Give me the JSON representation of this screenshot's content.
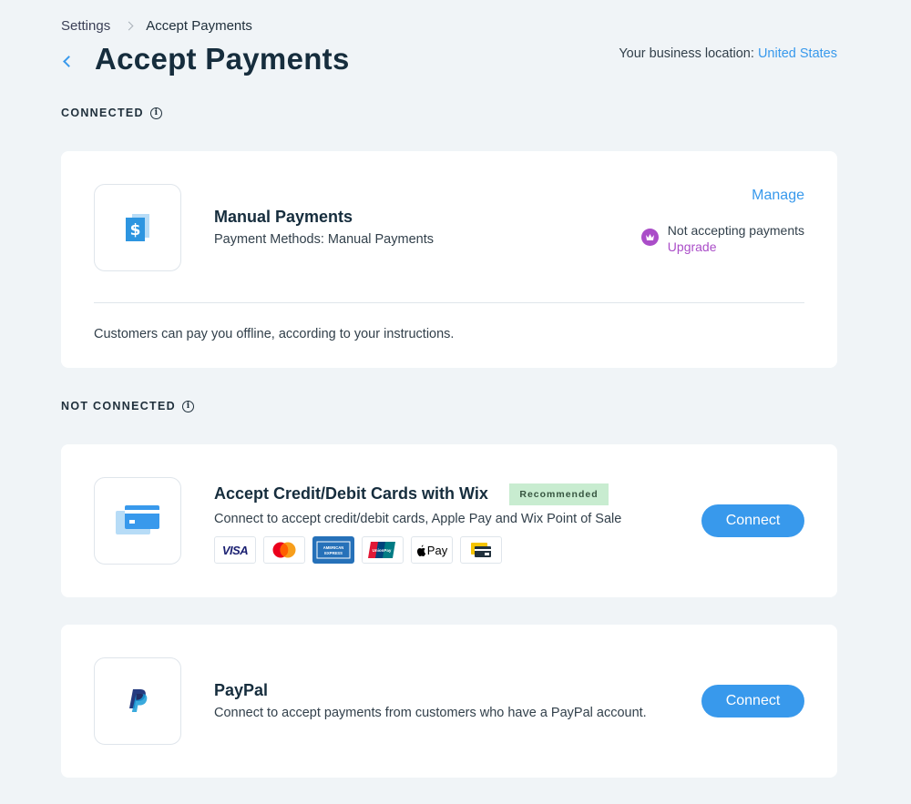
{
  "breadcrumb": {
    "parent": "Settings",
    "current": "Accept Payments"
  },
  "page": {
    "title": "Accept Payments"
  },
  "business_location": {
    "label": "Your business location:",
    "value": "United States"
  },
  "sections": {
    "connected": "CONNECTED",
    "not_connected": "NOT CONNECTED"
  },
  "manual": {
    "name": "Manual Payments",
    "methods": "Payment Methods: Manual Payments",
    "manage": "Manage",
    "status": "Not accepting payments",
    "upgrade": "Upgrade",
    "note": "Customers can pay you offline, according to your instructions."
  },
  "wix_cards": {
    "name": "Accept Credit/Debit Cards with Wix",
    "badge": "Recommended",
    "desc": "Connect to accept credit/debit cards, Apple Pay and Wix Point of Sale",
    "connect": "Connect",
    "logos": [
      "visa",
      "mastercard",
      "american-express",
      "unionpay",
      "apple-pay",
      "wix-pos"
    ]
  },
  "paypal": {
    "name": "PayPal",
    "desc": "Connect to accept payments from customers who have a PayPal account.",
    "connect": "Connect"
  },
  "logo_text": {
    "visa": "VISA",
    "apple_pay": "Pay",
    "amex": "AMERICAN EXPRESS",
    "unionpay": "UnionPay"
  },
  "colors": {
    "accent": "#3899ec",
    "premium": "#aa4dc8",
    "badge_bg": "#c8ecd0",
    "page_bg": "#f0f4f7"
  }
}
